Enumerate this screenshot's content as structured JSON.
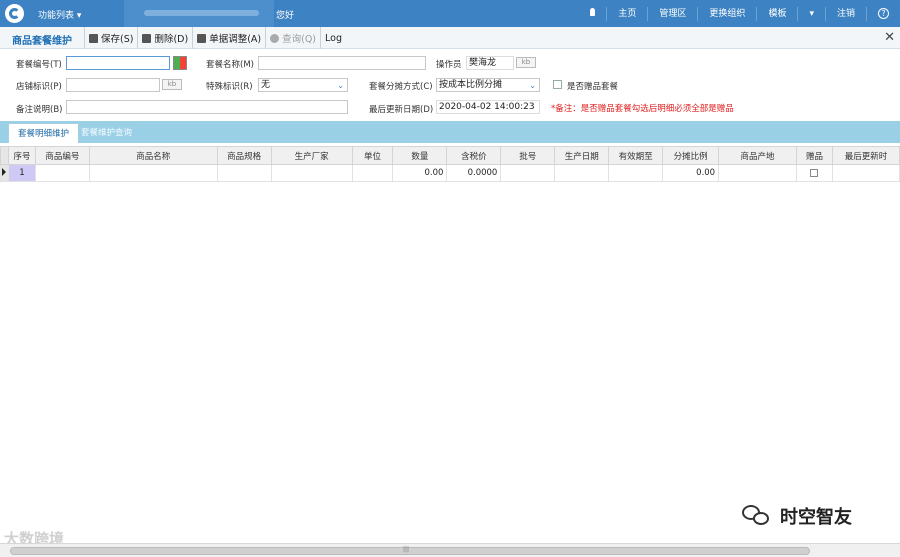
{
  "topbar": {
    "func_menu": "功能列表",
    "greeting": "您好",
    "items": [
      {
        "label": "主页"
      },
      {
        "label": "管理区"
      },
      {
        "label": "更换组织"
      },
      {
        "label": "模板"
      },
      {
        "label": "注销"
      }
    ]
  },
  "toolbar": {
    "title": "商品套餐维护",
    "buttons": [
      {
        "label": "保存(S)",
        "icon": "save-icon"
      },
      {
        "label": "删除(D)",
        "icon": "trash-icon"
      },
      {
        "label": "单据调整(A)",
        "icon": "adjust-icon"
      },
      {
        "label": "查询(Q)",
        "icon": "query-icon"
      },
      {
        "label": "Log"
      }
    ]
  },
  "form": {
    "package_no_label": "套餐编号(T)",
    "package_no_value": "",
    "package_name_label": "套餐名称(M)",
    "package_name_value": "",
    "operator_label": "操作员",
    "operator_value": "樊海龙",
    "shop_label": "店铺标识(P)",
    "shop_value": "",
    "special_label": "特殊标识(R)",
    "special_value": "无",
    "split_label": "套餐分摊方式(C)",
    "split_value": "按成本比例分摊",
    "gift_package_label": "是否赠品套餐",
    "remark_label": "备注说明(B)",
    "remark_value": "",
    "last_update_label": "最后更新日期(D)",
    "last_update_value": "2020-04-02 14:00:23",
    "note": "*备注：是否赠品套餐勾选后明细必须全部是赠品"
  },
  "tabs": [
    {
      "label": "套餐明细维护"
    },
    {
      "label": "套餐维护查询"
    }
  ],
  "grid": {
    "columns": [
      "序号",
      "商品编号",
      "商品名称",
      "商品规格",
      "生产厂家",
      "单位",
      "数量",
      "含税价",
      "批号",
      "生产日期",
      "有效期至",
      "分摊比例",
      "商品产地",
      "赠品",
      "最后更新时"
    ],
    "rows": [
      {
        "seq": "1",
        "code": "",
        "name": "",
        "spec": "",
        "maker": "",
        "unit": "",
        "qty": "0.00",
        "price": "0.0000",
        "batch": "",
        "prod_date": "",
        "expiry": "",
        "ratio": "0.00",
        "origin": "",
        "last": ""
      }
    ]
  },
  "watermarks": {
    "left": "大数跨境",
    "right": "时空智友"
  },
  "colors": {
    "topbar": "#3d82c2",
    "tabbar": "#9ad0e6",
    "title": "#1f6fb5",
    "note": "#e02020"
  }
}
